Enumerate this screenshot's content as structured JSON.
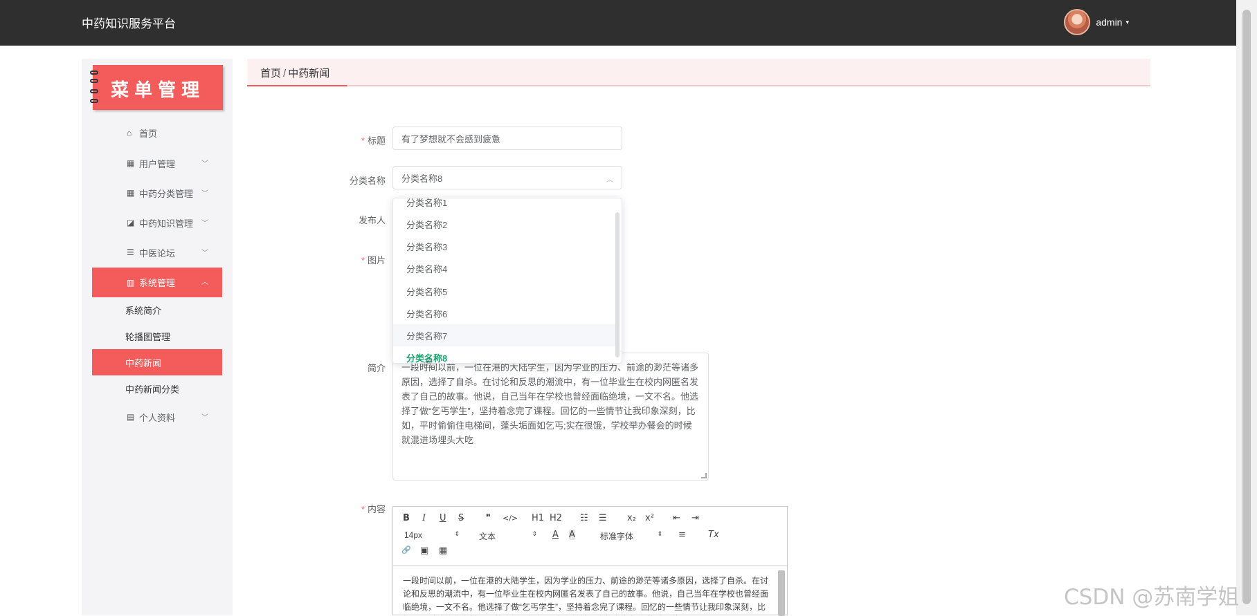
{
  "header": {
    "app_title": "中药知识服务平台",
    "username": "admin",
    "caret": "▾"
  },
  "sidebar": {
    "banner_title": "菜单管理",
    "items": [
      {
        "icon": "home-icon",
        "glyph": "⌂",
        "label": "首页"
      },
      {
        "icon": "grid-icon",
        "glyph": "▦",
        "label": "用户管理",
        "chevron": "﹀"
      },
      {
        "icon": "grid-icon",
        "glyph": "▦",
        "label": "中药分类管理",
        "chevron": "﹀"
      },
      {
        "icon": "chart-icon",
        "glyph": "◪",
        "label": "中药知识管理",
        "chevron": "﹀"
      },
      {
        "icon": "list-icon",
        "glyph": "☰",
        "label": "中医论坛",
        "chevron": "﹀"
      },
      {
        "icon": "system-icon",
        "glyph": "▥",
        "label": "系统管理",
        "chevron": "︿"
      }
    ],
    "sub_items": [
      "系统简介",
      "轮播图管理",
      "中药新闻",
      "中药新闻分类"
    ],
    "profile": {
      "icon": "profile-icon",
      "glyph": "▤",
      "label": "个人资料",
      "chevron": "﹀"
    }
  },
  "breadcrumb": {
    "home": "首页",
    "separator": "/",
    "current": "中药新闻"
  },
  "form": {
    "required_mark": "*",
    "title_label": "标题",
    "title_value": "有了梦想就不会感到疲惫",
    "category_label": "分类名称",
    "category_value": "分类名称8",
    "category_arrow": "︿",
    "publisher_label": "发布人",
    "image_label": "图片",
    "intro_label": "简介",
    "intro_text": "一段时间以前，一位在港的大陆学生，因为学业的压力、前途的渺茫等诸多原因，选择了自杀。在讨论和反思的潮流中，有一位毕业生在校内网匿名发表了自己的故事。他说，自己当年在学校也曾经面临绝境，一文不名。他选择了做“乞丐学生”，坚持着念完了课程。回忆的一些情节让我印象深刻，比如，平时偷偷住电梯间，蓬头垢面如乞丐;实在很饿，学校举办餐会的时候就混进场埋头大吃",
    "content_label": "内容"
  },
  "dropdown": {
    "options": [
      "分类名称1",
      "分类名称2",
      "分类名称3",
      "分类名称4",
      "分类名称5",
      "分类名称6",
      "分类名称7",
      "分类名称8"
    ],
    "hovered": "分类名称7",
    "selected": "分类名称8"
  },
  "editor": {
    "toolbar": {
      "bold": "B",
      "italic": "I",
      "underline": "U",
      "strike": "S",
      "quote": "❞",
      "code": "</>",
      "h1": "H1",
      "h2": "H2",
      "ordered_list": "☷",
      "bullet_list": "☰",
      "subscript": "x₂",
      "superscript": "x²",
      "outdent": "⇤",
      "indent": "⇥",
      "size": "14px",
      "header": "文本",
      "font": "标准字体",
      "color": "A",
      "background": "A",
      "align": "≡",
      "clean": "Tx",
      "link": "🔗",
      "image": "▣",
      "video": "▦",
      "select_arrow": "⇕"
    },
    "body_text": "一段时间以前，一位在港的大陆学生，因为学业的压力、前途的渺茫等诸多原因，选择了自杀。在讨论和反思的潮流中，有一位毕业生在校内网匿名发表了自己的故事。他说，自己当年在学校也曾经面临绝境，一文不名。他选择了做“乞丐学生”，坚持着念完了课程。回忆的一些情节让我印象深刻，比如，平时偷偷住电梯间，蓬头垢面如乞丐;实在很饿，学校举办餐会的时候就混进场"
  },
  "watermark": "CSDN @苏南学姐",
  "colors": {
    "topbar": "#2f2f2f",
    "accent": "#f45b5b",
    "selected_option": "#1aa36f",
    "breadcrumb_bg": "#fdf0f0"
  }
}
